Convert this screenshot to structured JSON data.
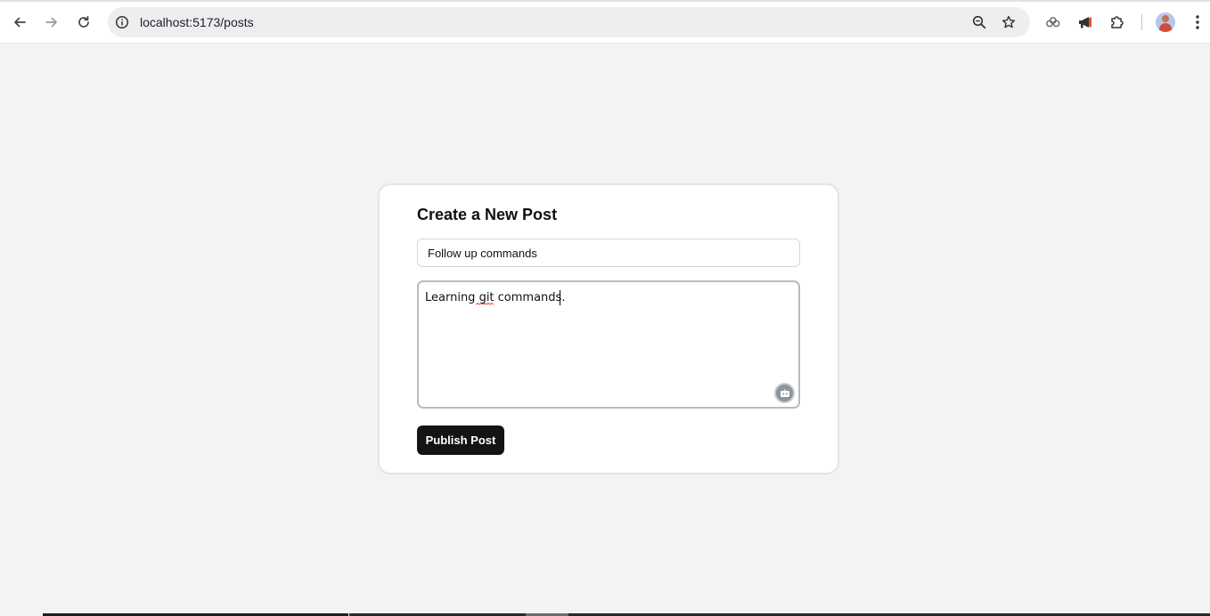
{
  "browser": {
    "url": "localhost:5173/posts",
    "icons": {
      "back": "arrow-left-icon",
      "forward": "arrow-right-icon",
      "reload": "reload-icon",
      "site_info": "info-icon",
      "zoom": "zoom-icon",
      "bookmark": "star-icon",
      "extension1": "cloud-extension-icon",
      "extension2": "megaphone-icon",
      "extensions": "puzzle-icon",
      "menu": "kebab-menu-icon"
    }
  },
  "form": {
    "heading": "Create a New Post",
    "title_value": "Follow up commands",
    "body_value": "Learning git commands.",
    "publish_label": "Publish Post"
  },
  "colors": {
    "page_bg": "#f2f3f5",
    "card_bg": "#ffffff",
    "button_bg": "#141414",
    "button_text": "#ffffff"
  }
}
